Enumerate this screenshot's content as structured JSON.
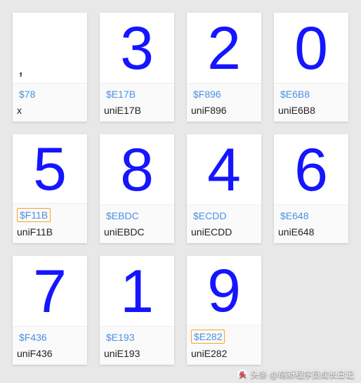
{
  "cards": [
    {
      "glyph": ",",
      "code": "$78",
      "name": "x",
      "small": true,
      "highlighted": false
    },
    {
      "glyph": "3",
      "code": "$E17B",
      "name": "uniE17B",
      "small": false,
      "highlighted": false
    },
    {
      "glyph": "2",
      "code": "$F896",
      "name": "uniF896",
      "small": false,
      "highlighted": false
    },
    {
      "glyph": "0",
      "code": "$E6B8",
      "name": "uniE6B8",
      "small": false,
      "highlighted": false
    },
    {
      "glyph": "5",
      "code": "$F11B",
      "name": "uniF11B",
      "small": false,
      "highlighted": true
    },
    {
      "glyph": "8",
      "code": "$EBDC",
      "name": "uniEBDC",
      "small": false,
      "highlighted": false
    },
    {
      "glyph": "4",
      "code": "$ECDD",
      "name": "uniECDD",
      "small": false,
      "highlighted": false
    },
    {
      "glyph": "6",
      "code": "$E648",
      "name": "uniE648",
      "small": false,
      "highlighted": false
    },
    {
      "glyph": "7",
      "code": "$F436",
      "name": "uniF436",
      "small": false,
      "highlighted": false
    },
    {
      "glyph": "1",
      "code": "$E193",
      "name": "uniE193",
      "small": false,
      "highlighted": false
    },
    {
      "glyph": "9",
      "code": "$E282",
      "name": "uniE282",
      "small": false,
      "highlighted": true
    }
  ],
  "watermark": {
    "text": "头条 @萌新程序员成长日记"
  }
}
